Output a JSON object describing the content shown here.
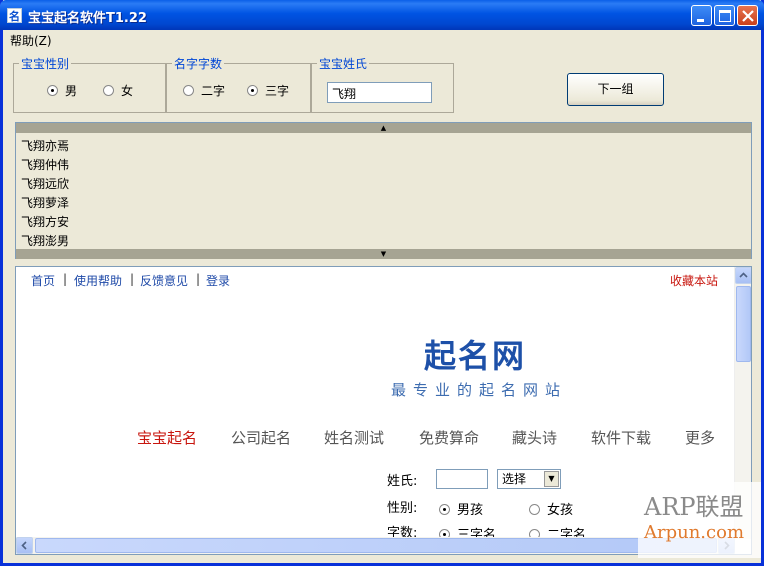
{
  "window": {
    "title": "宝宝起名软件T1.22",
    "icon_char": "名"
  },
  "menu": {
    "help": "帮助(Z)"
  },
  "gender_group": {
    "legend": "宝宝性别",
    "options": [
      "男",
      "女"
    ],
    "selected": "男"
  },
  "length_group": {
    "legend": "名字字数",
    "options": [
      "二字",
      "三字"
    ],
    "selected": "三字"
  },
  "surname_group": {
    "legend": "宝宝姓氏",
    "value": "飞翔"
  },
  "next_button": {
    "label": "下一组"
  },
  "names": [
    "飞翔亦焉",
    "飞翔仲伟",
    "飞翔远欣",
    "飞翔萝泽",
    "飞翔方安",
    "飞翔澎男"
  ],
  "browser": {
    "toplinks": [
      "首页",
      "使用帮助",
      "反馈意见",
      "登录"
    ],
    "separator": "|",
    "bookmark": "收藏本站",
    "logo": "起名网",
    "slogan": "最专业的起名网站",
    "categories": [
      "宝宝起名",
      "公司起名",
      "姓名测试",
      "免费算命",
      "藏头诗",
      "软件下载",
      "更多"
    ],
    "form": {
      "surname_label": "姓氏:",
      "select_label": "选择",
      "gender_label": "性别:",
      "gender_options": [
        "男孩",
        "女孩"
      ],
      "count_label": "字数:",
      "count_options": [
        "三字名",
        "二字名"
      ]
    }
  },
  "watermark": {
    "line1": "ARP联盟",
    "line2": "Arpun.com"
  },
  "colors": {
    "title_blue": "#0054e3",
    "link_blue": "#1f4aa8",
    "legend_blue": "#0046d5",
    "active_red": "#c8160e",
    "logo_blue": "#1d50a8"
  }
}
